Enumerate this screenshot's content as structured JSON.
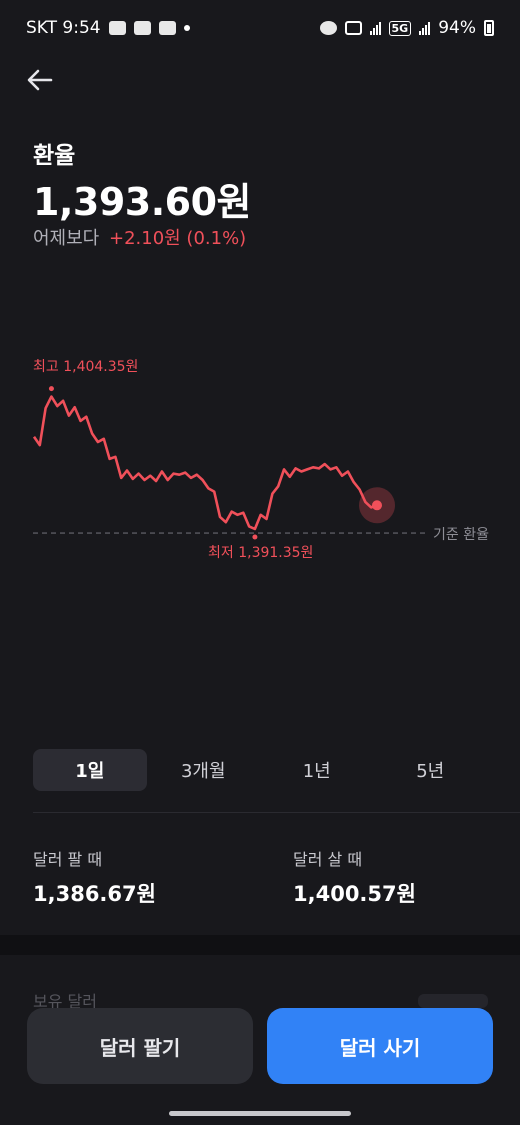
{
  "status_bar": {
    "carrier_time": "SKT 9:54",
    "battery": "94%",
    "network": "5G"
  },
  "header": {
    "title": "환율",
    "rate": "1,393.60원",
    "change_label": "어제보다",
    "change_value": "+2.10원 (0.1%)"
  },
  "chart": {
    "high_label": "최고 1,404.35원",
    "low_label": "최저 1,391.35원",
    "reference_label": "기준 환율",
    "line_color": "#f0505a"
  },
  "chart_data": {
    "type": "line",
    "title": "",
    "xlabel": "",
    "ylabel": "",
    "ylim": [
      1390.5,
      1405
    ],
    "reference_value": 1390.97,
    "series": [
      {
        "values": [
          1400.1,
          1399.3,
          1402.8,
          1403.9,
          1403.0,
          1403.5,
          1402.1,
          1402.9,
          1401.6,
          1402.0,
          1400.4,
          1399.6,
          1399.9,
          1398.0,
          1398.2,
          1396.2,
          1396.9,
          1396.1,
          1396.6,
          1396.0,
          1396.4,
          1395.9,
          1396.8,
          1396.0,
          1396.6,
          1396.5,
          1396.7,
          1396.2,
          1396.5,
          1396.0,
          1395.2,
          1394.9,
          1392.5,
          1392.0,
          1393.0,
          1392.7,
          1392.9,
          1391.6,
          1391.35,
          1392.7,
          1392.3,
          1394.7,
          1395.4,
          1397.0,
          1396.3,
          1397.1,
          1396.8,
          1397.0,
          1397.2,
          1397.1,
          1397.5,
          1397.0,
          1397.2,
          1396.4,
          1396.8,
          1395.8,
          1395.1,
          1393.9,
          1393.4,
          1393.6
        ]
      }
    ]
  },
  "period_tabs": [
    {
      "label": "1일",
      "active": true
    },
    {
      "label": "3개월",
      "active": false
    },
    {
      "label": "1년",
      "active": false
    },
    {
      "label": "5년",
      "active": false
    }
  ],
  "prices": {
    "sell_label": "달러 팔 때",
    "sell_value": "1,386.67원",
    "buy_label": "달러 살 때",
    "buy_value": "1,400.57원"
  },
  "holdings": {
    "label": "보유 달러"
  },
  "buttons": {
    "sell": "달러 팔기",
    "buy": "달러 사기"
  },
  "colors": {
    "accent_red": "#f0505a",
    "accent_blue": "#3182f6",
    "background": "#18181c"
  }
}
